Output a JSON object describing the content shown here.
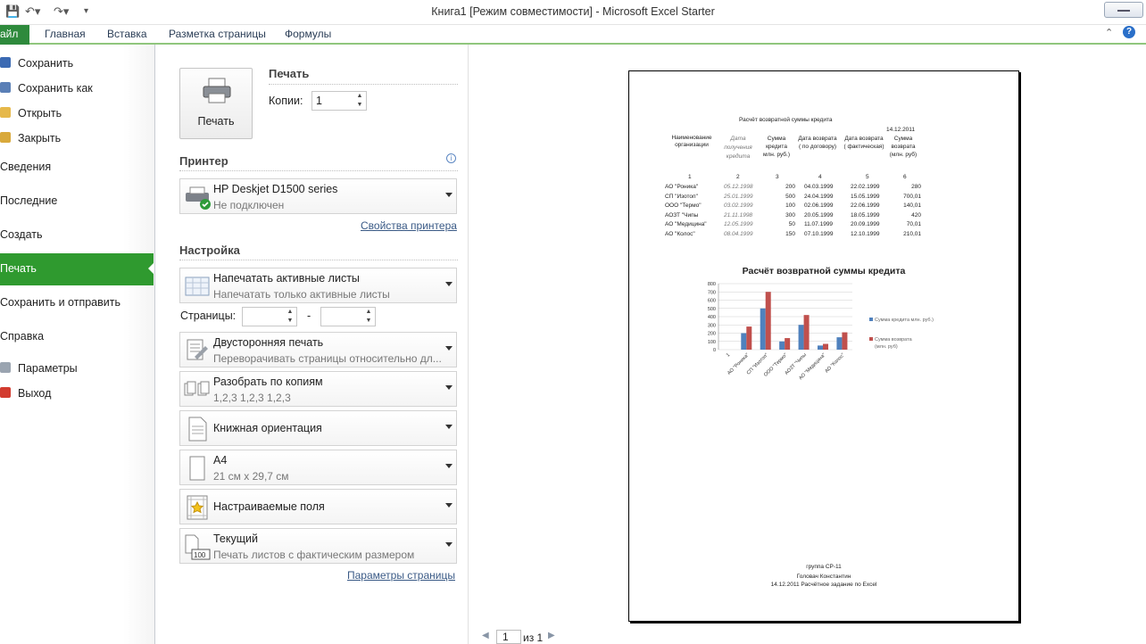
{
  "window": {
    "title": "Книга1  [Режим совместимости]  -  Microsoft Excel Starter"
  },
  "ribbon": {
    "file": "айл",
    "tabs": [
      "Главная",
      "Вставка",
      "Разметка страницы",
      "Формулы"
    ]
  },
  "nav": {
    "save": "Сохранить",
    "save_as": "Сохранить как",
    "open": "Открыть",
    "close": "Закрыть",
    "info": "Сведения",
    "recent": "Последние",
    "new": "Создать",
    "print": "Печать",
    "share": "Сохранить и отправить",
    "help": "Справка",
    "options": "Параметры",
    "exit": "Выход"
  },
  "print": {
    "button_label": "Печать",
    "section_title": "Печать",
    "copies_label": "Копии:",
    "copies_value": "1",
    "printer_title": "Принтер",
    "printer_name": "HP Deskjet D1500 series",
    "printer_status": "Не подключен",
    "printer_props": "Свойства принтера",
    "settings_title": "Настройка",
    "active_sheets": "Напечатать активные листы",
    "active_sheets_sub": "Напечатать только активные листы",
    "pages_label": "Страницы:",
    "pages_dash": "-",
    "duplex": "Двусторонняя печать",
    "duplex_sub": "Переворачивать страницы относительно дл...",
    "collate": "Разобрать по копиям",
    "collate_sub": "1,2,3    1,2,3    1,2,3",
    "orientation": "Книжная ориентация",
    "paper": "А4",
    "paper_sub": "21 см x 29,7 см",
    "margins": "Настраиваемые поля",
    "scaling": "Текущий",
    "scaling_sub": "Печать листов с фактическим размером",
    "page_setup": "Параметры страницы"
  },
  "pager": {
    "current": "1",
    "of": "из 1"
  },
  "sheet": {
    "title": "Расчёт возвратной суммы кредита",
    "date": "14.12.2011",
    "headers": [
      "Наименование организации",
      "Дата получения кредита",
      "Сумма кредита млн. руб.)",
      "Дата возврата ( по договору)",
      "Дата возврата ( фактическая)",
      "Сумма возврата (млн. руб)"
    ],
    "colnums": [
      "1",
      "2",
      "3",
      "4",
      "5",
      "6"
    ],
    "rows": [
      [
        "АО \"Роника\"",
        "05.12.1998",
        "200",
        "04.03.1999",
        "22.02.1999",
        "280"
      ],
      [
        "СП \"Изотоп\"",
        "25.01.1999",
        "500",
        "24.04.1999",
        "15.05.1999",
        "700,01"
      ],
      [
        "ООО \"Термо\"",
        "03.02.1999",
        "100",
        "02.06.1999",
        "22.06.1999",
        "140,01"
      ],
      [
        "АОЗТ \"Чипы",
        "21.11.1998",
        "300",
        "20.05.1999",
        "18.05.1999",
        "420"
      ],
      [
        "АО \"Медицина\"",
        "12.05.1999",
        "50",
        "11.07.1999",
        "20.09.1999",
        "70,01"
      ],
      [
        "АО \"Колос\"",
        "08.04.1999",
        "150",
        "07.10.1999",
        "12.10.1999",
        "210,01"
      ]
    ],
    "footer": [
      "группа СР-11",
      "Головач Константин",
      "14.12.2011 Расчётное задание по Excel"
    ]
  },
  "chart_data": {
    "type": "bar",
    "title": "Расчёт возвратной суммы кредита",
    "categories": [
      "1",
      "АО \"Роника\"",
      "СП \"Изотоп\"",
      "ООО \"Термо\"",
      "АОЗТ \"Чипы",
      "АО \"Медицина\"",
      "АО \"Колос\""
    ],
    "series": [
      {
        "name": "Сумма кредита млн. руб.)",
        "values": [
          0,
          200,
          500,
          100,
          300,
          50,
          150
        ],
        "color": "#4f81bd"
      },
      {
        "name": "Сумма возврата (млн. руб)",
        "values": [
          0,
          280,
          700.01,
          140.01,
          420,
          70.01,
          210.01
        ],
        "color": "#c0504d"
      }
    ],
    "yticks": [
      "0",
      "100",
      "200",
      "300",
      "400",
      "500",
      "600",
      "700",
      "800"
    ],
    "ylim": [
      0,
      800
    ],
    "grid": true,
    "legend": "right"
  },
  "colors": {
    "accent": "#2f9a2f",
    "file_tab": "#2e8a3c"
  }
}
